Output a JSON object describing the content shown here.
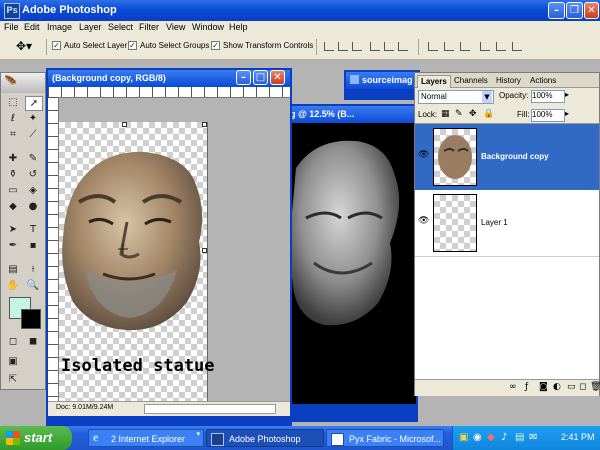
{
  "app": {
    "title": "Adobe Photoshop"
  },
  "menu": [
    "File",
    "Edit",
    "Image",
    "Layer",
    "Select",
    "Filter",
    "View",
    "Window",
    "Help"
  ],
  "options": {
    "auto_select_layer": "Auto Select Layer",
    "auto_select_groups": "Auto Select Groups",
    "show_transform_controls": "Show Transform Controls"
  },
  "doc_main": {
    "title": "(Background copy, RGB/8)",
    "overlay_text": "Isolated statue",
    "status": "Doc: 9.01M/9.24M"
  },
  "doc_second": {
    "title": "g @ 12.5% (B..."
  },
  "doc_source": {
    "title": "sourceimag"
  },
  "layers_panel": {
    "tabs": [
      "Layers",
      "Channels",
      "History",
      "Actions"
    ],
    "blend_mode": "Normal",
    "opacity_label": "Opacity:",
    "opacity_value": "100%",
    "lock_label": "Lock:",
    "fill_label": "Fill:",
    "fill_value": "100%",
    "layers": [
      {
        "name": "Background copy",
        "selected": true
      },
      {
        "name": "Layer 1",
        "selected": false
      }
    ]
  },
  "taskbar": {
    "start": "start",
    "tasks": [
      "2 Internet Explorer",
      "Adobe Photoshop",
      "Pyx Fabric - Microsof..."
    ],
    "clock": "2:41 PM"
  },
  "colors": {
    "accent": "#0a3fc2",
    "selection": "#316ac5",
    "face": "#ece9d8"
  }
}
